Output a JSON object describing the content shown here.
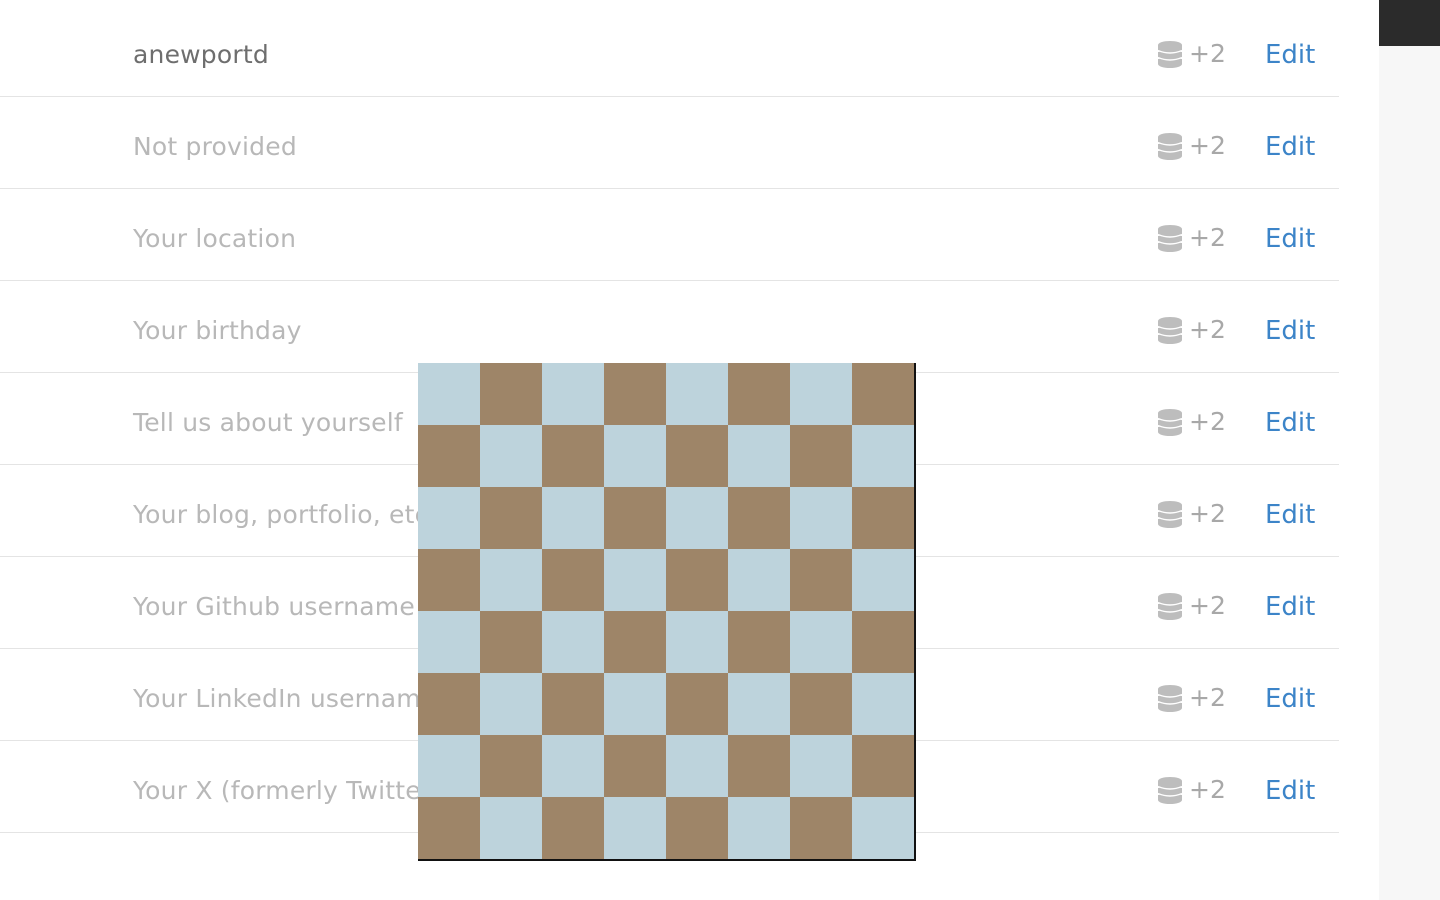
{
  "profile_rows": [
    {
      "value": "anewportd",
      "filled": true,
      "cost": "+2",
      "edit": "Edit"
    },
    {
      "value": "Not provided",
      "filled": false,
      "cost": "+2",
      "edit": "Edit"
    },
    {
      "value": "Your location",
      "filled": false,
      "cost": "+2",
      "edit": "Edit"
    },
    {
      "value": "Your birthday",
      "filled": false,
      "cost": "+2",
      "edit": "Edit"
    },
    {
      "value": "Tell us about yourself",
      "filled": false,
      "cost": "+2",
      "edit": "Edit"
    },
    {
      "value": "Your blog, portfolio, etc.",
      "filled": false,
      "cost": "+2",
      "edit": "Edit"
    },
    {
      "value": "Your Github username",
      "filled": false,
      "cost": "+2",
      "edit": "Edit"
    },
    {
      "value": "Your LinkedIn username",
      "filled": false,
      "cost": "+2",
      "edit": "Edit"
    },
    {
      "value": "Your X (formerly Twitter) username",
      "filled": false,
      "cost": "+2",
      "edit": "Edit"
    }
  ],
  "icons": {
    "cost": "coin-stack-icon"
  },
  "colors": {
    "link": "#3c84c8",
    "placeholder_text": "#b8b8b8",
    "value_text": "#6e6e6e",
    "board_light": "#bdd3dc",
    "board_dark": "#9e8568"
  },
  "board": {
    "size": 8
  }
}
